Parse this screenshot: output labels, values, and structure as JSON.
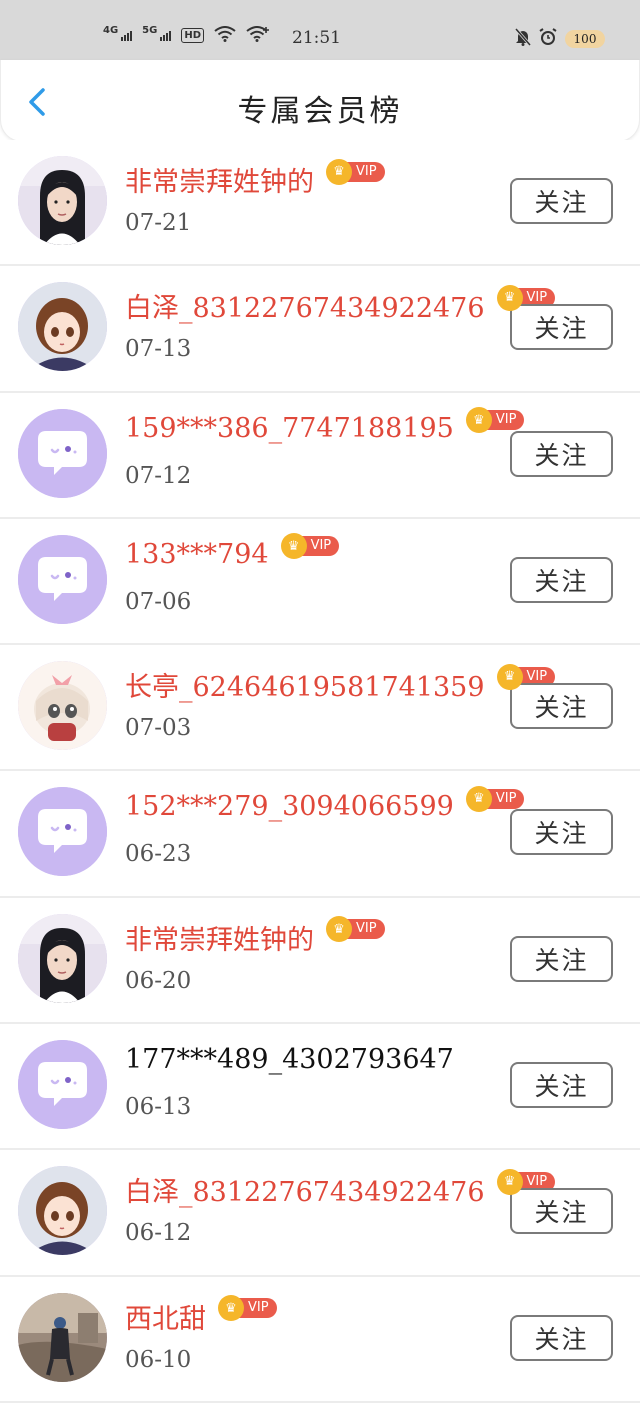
{
  "status_bar": {
    "network1": "4G",
    "network2": "5G",
    "hd": "HD",
    "time": "21:51",
    "battery": "100"
  },
  "header": {
    "title": "专属会员榜"
  },
  "colors": {
    "vip_name": "#e0483a",
    "vip_tag": "#ea5b4b",
    "crown": "#f5b62a",
    "back_arrow": "#2f9be8",
    "default_avatar": "#c9b8f2"
  },
  "vip_label": "VIP",
  "follow_label": "关注",
  "members": [
    {
      "name": "非常崇拜姓钟的",
      "date": "07-21",
      "vip": true,
      "avatar": "photo-man"
    },
    {
      "name": "白泽_83122767434922476",
      "date": "07-13",
      "vip": true,
      "avatar": "anime-girl"
    },
    {
      "name": "159***386_7747188195",
      "date": "07-12",
      "vip": true,
      "avatar": "default"
    },
    {
      "name": "133***794",
      "date": "07-06",
      "vip": true,
      "avatar": "default"
    },
    {
      "name": "长亭_62464619581741359",
      "date": "07-03",
      "vip": true,
      "avatar": "chibi"
    },
    {
      "name": "152***279_3094066599",
      "date": "06-23",
      "vip": true,
      "avatar": "default"
    },
    {
      "name": "非常崇拜姓钟的",
      "date": "06-20",
      "vip": true,
      "avatar": "photo-man"
    },
    {
      "name": "177***489_4302793647",
      "date": "06-13",
      "vip": false,
      "avatar": "default"
    },
    {
      "name": "白泽_83122767434922476",
      "date": "06-12",
      "vip": true,
      "avatar": "anime-girl"
    },
    {
      "name": "西北甜",
      "date": "06-10",
      "vip": true,
      "avatar": "photo-scene"
    }
  ]
}
